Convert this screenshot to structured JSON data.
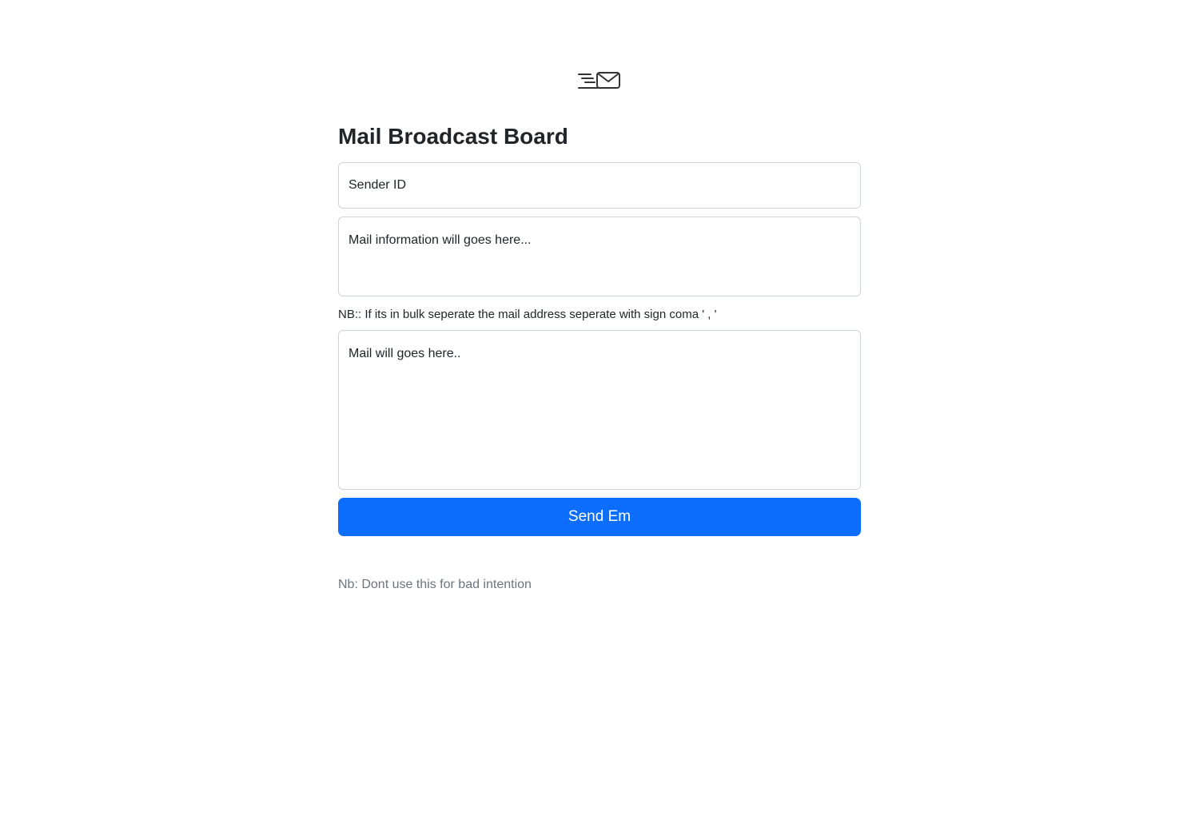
{
  "header": {
    "logo_icon": "mail-send-icon",
    "title": "Mail Broadcast Board"
  },
  "form": {
    "sender_placeholder": "Sender ID",
    "sender_value": "",
    "info_placeholder": "Mail information will goes here...",
    "info_value": "",
    "bulk_note": "NB:: If its in bulk seperate the mail address seperate with sign coma ' , '",
    "recipients_placeholder": "Mail will goes here..",
    "recipients_value": "",
    "send_label": "Send Em"
  },
  "footer": {
    "note": "Nb: Dont use this for bad intention"
  },
  "colors": {
    "accent": "#0d6efd",
    "text": "#212529",
    "muted": "#6c757d",
    "border": "#ced4da"
  }
}
